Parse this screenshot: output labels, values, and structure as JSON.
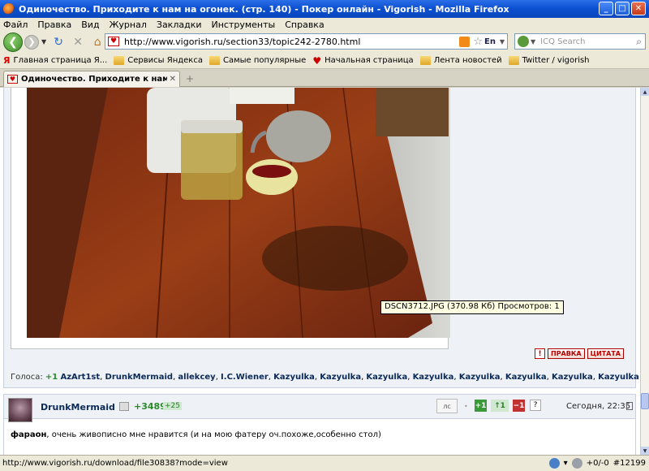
{
  "window": {
    "title": "Одиночество. Приходите к нам на огонек. (стр. 140) - Покер онлайн - Vigorish - Mozilla Firefox",
    "minimize": "_",
    "maximize": "□",
    "close": "✕"
  },
  "menu": [
    "Файл",
    "Правка",
    "Вид",
    "Журнал",
    "Закладки",
    "Инструменты",
    "Справка"
  ],
  "nav": {
    "url": "http://www.vigorish.ru/section33/topic242-2780.html",
    "lang": "En",
    "search_placeholder": "ICQ Search"
  },
  "bookmarks": [
    {
      "label": "Главная страница Я...",
      "icon": "yandex-icon"
    },
    {
      "label": "Сервисы Яндекса",
      "icon": "folder-icon"
    },
    {
      "label": "Самые популярные",
      "icon": "folder-icon"
    },
    {
      "label": "Начальная страница",
      "icon": "heart-icon"
    },
    {
      "label": "Лента новостей",
      "icon": "folder-icon"
    },
    {
      "label": "Twitter / vigorish",
      "icon": "folder-icon"
    }
  ],
  "tab": {
    "label": "Одиночество. Приходите к нам на о...",
    "new_tab": "+"
  },
  "post1": {
    "tooltip": "DSCN3712.JPG (370.98 Кб) Просмотров: 1",
    "warn": "!",
    "edit_label": "ПРАВКА",
    "quote_label": "ЦИТАТА",
    "votes_label": "Голоса:",
    "votes_count": "+1",
    "voters": [
      "AzArt1st",
      "DrunkMermaid",
      "allekcey",
      "I.C.Wiener",
      "Kazyulka",
      "Kazyulka",
      "Kazyulka",
      "Kazyulka",
      "Kazyulka",
      "Kazyulka",
      "Kazyulka",
      "Kazyulka"
    ]
  },
  "post2": {
    "username": "DrunkMermaid",
    "rating": "+3489",
    "rating_inc": "+25",
    "ls_label": "лс",
    "vote_plus": "+1",
    "vote_up": "↑1",
    "vote_minus": "−1",
    "vote_q": "?",
    "time": "Сегодня, 22:35",
    "author_ref": "фараон",
    "text": ", очень живописно мне нравится (и на мою фатеру оч.похоже,особенно стол)"
  },
  "status": {
    "url": "http://www.vigorish.ru/download/file30838?mode=view",
    "counter": "+0/-0",
    "number": "#12199"
  },
  "colors": {
    "titlebar": "#0a4fcf",
    "vote_green": "#2a8a2a",
    "vote_red": "#c03030",
    "link_navy": "#0b2a58"
  }
}
